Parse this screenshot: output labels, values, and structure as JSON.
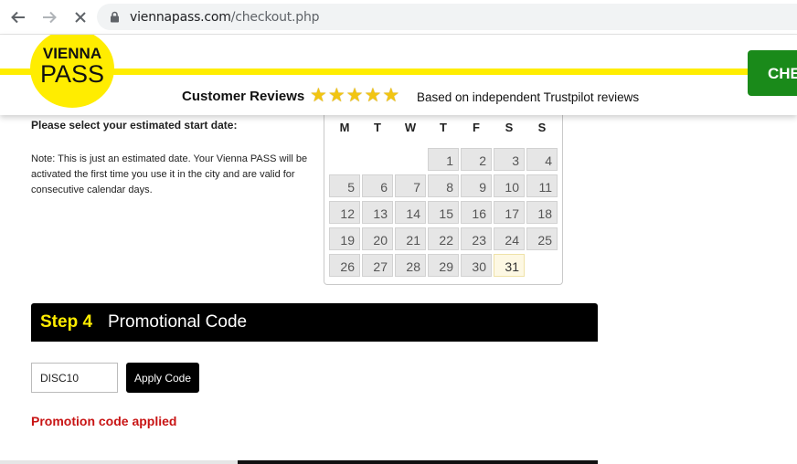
{
  "browser": {
    "url_domain": "viennapass.com",
    "url_path": "/checkout.php",
    "icons": [
      "back-icon",
      "forward-icon",
      "stop-loading-icon",
      "lock-icon"
    ]
  },
  "header": {
    "logo_top": "VIENNA",
    "logo_bottom": "PASS",
    "reviews_label": "Customer Reviews",
    "reviews_note": "Based on independent Trustpilot reviews",
    "stars": [
      "★",
      "★",
      "★",
      "★",
      "★"
    ],
    "checkout_label": "CHE",
    "colors": {
      "brand_yellow": "#ffed00",
      "checkout_green": "#1a8a1a"
    }
  },
  "date_section": {
    "title": "Please select your estimated start date:",
    "note": "Note: This is just an estimated date. Your Vienna PASS will be activated the first time you use it in the city and are valid for consecutive calendar days."
  },
  "calendar": {
    "weekdays": [
      "M",
      "T",
      "W",
      "T",
      "F",
      "S",
      "S"
    ],
    "weeks": [
      [
        "",
        "",
        "",
        "1",
        "2",
        "3",
        "4"
      ],
      [
        "5",
        "6",
        "7",
        "8",
        "9",
        "10",
        "11"
      ],
      [
        "12",
        "13",
        "14",
        "15",
        "16",
        "17",
        "18"
      ],
      [
        "19",
        "20",
        "21",
        "22",
        "23",
        "24",
        "25"
      ],
      [
        "26",
        "27",
        "28",
        "29",
        "30",
        "31",
        ""
      ]
    ],
    "highlighted_day": "31"
  },
  "step4": {
    "number": "Step 4",
    "title": "Promotional Code",
    "input_value": "DISC10",
    "apply_label": "Apply Code",
    "status": "Promotion code applied",
    "status_color": "#c81414"
  }
}
